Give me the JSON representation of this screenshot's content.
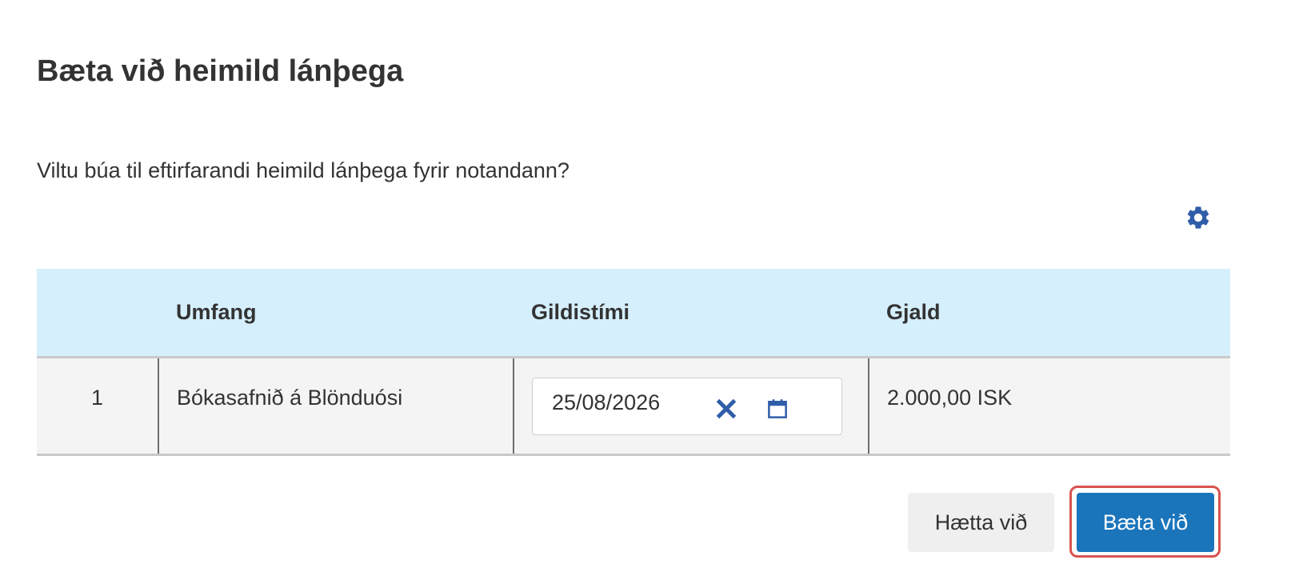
{
  "dialog": {
    "title": "Bæta við heimild lánþega",
    "prompt": "Viltu búa til eftirfarandi heimild lánþega fyrir notandann?"
  },
  "toolbar": {
    "settings_icon": "gear-icon",
    "accent_color": "#2f5da8"
  },
  "table": {
    "headers": [
      "",
      "Umfang",
      "Gildistími",
      "Gjald"
    ],
    "header_bg": "#d6effd",
    "rows": [
      {
        "index": "1",
        "scope": "Bókasafnið á Blönduósi",
        "expiry_date": "25/08/2026",
        "fee": "2.000,00 ISK"
      }
    ]
  },
  "date_field": {
    "clear_icon": "close-icon",
    "calendar_icon": "calendar-icon"
  },
  "actions": {
    "cancel_label": "Hætta við",
    "confirm_label": "Bæta við",
    "primary_color": "#1b75bb",
    "focus_outline_color": "#d9534f"
  }
}
